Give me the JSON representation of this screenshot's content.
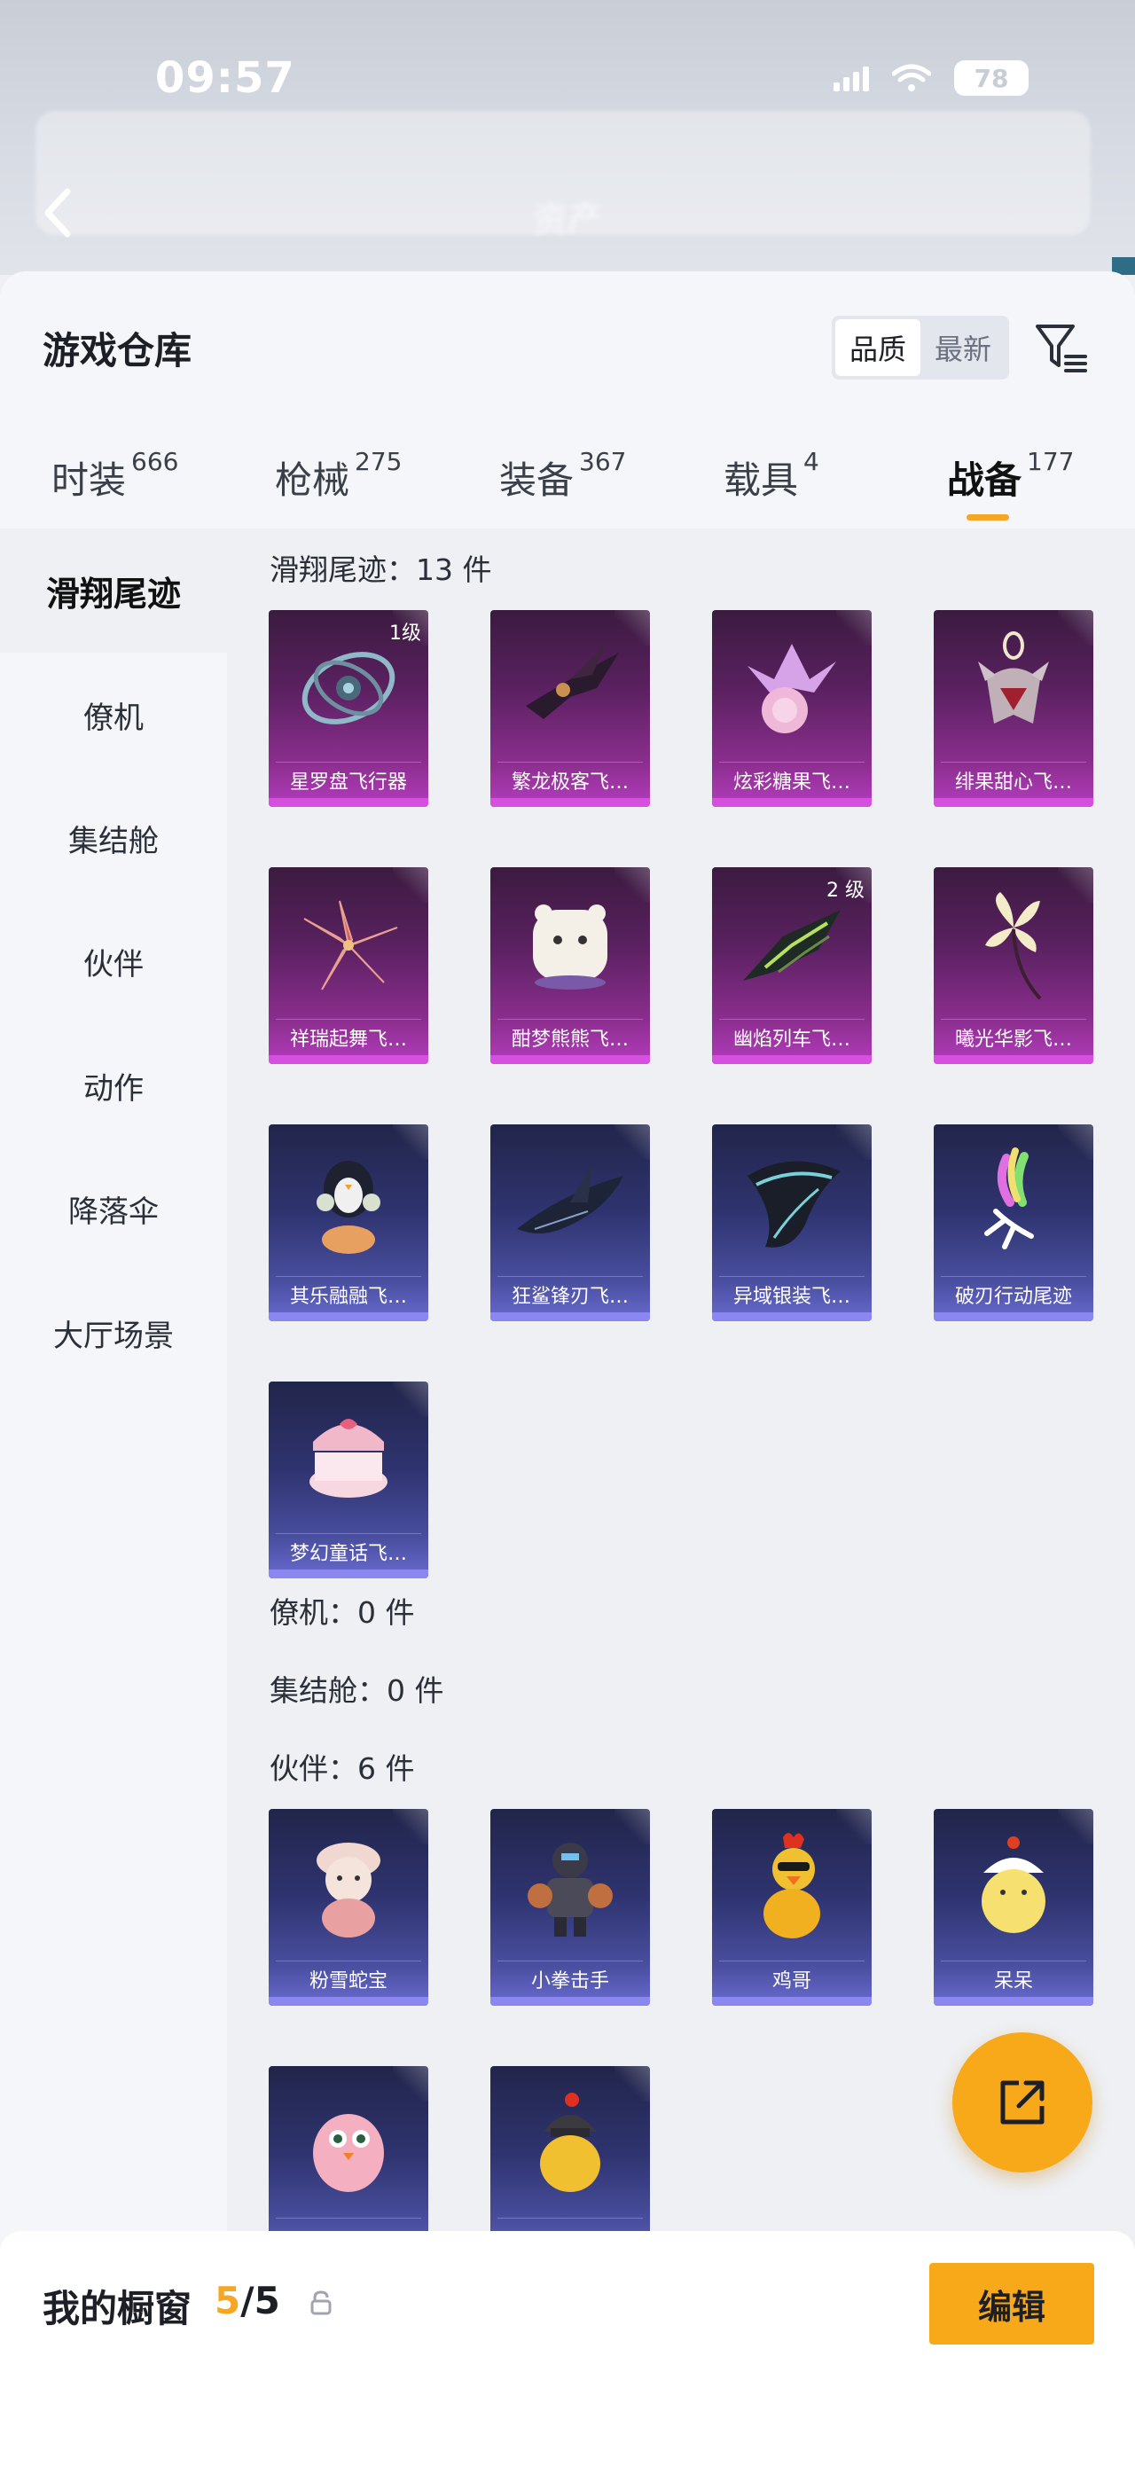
{
  "status_bar": {
    "time": "09:57",
    "battery": "78"
  },
  "header_bg": {
    "tab_hint": "资产"
  },
  "sheet": {
    "title": "游戏仓库",
    "sort": {
      "options": [
        "品质",
        "最新"
      ],
      "selected": "品质"
    }
  },
  "category_tabs": [
    {
      "label": "时装",
      "count": "666"
    },
    {
      "label": "枪械",
      "count": "275"
    },
    {
      "label": "装备",
      "count": "367"
    },
    {
      "label": "载具",
      "count": "4"
    },
    {
      "label": "战备",
      "count": "177",
      "active": true
    }
  ],
  "side_nav": [
    {
      "label": "滑翔尾迹",
      "active": true
    },
    {
      "label": "僚机"
    },
    {
      "label": "集结舱"
    },
    {
      "label": "伙伴"
    },
    {
      "label": "动作"
    },
    {
      "label": "降落伞"
    },
    {
      "label": "大厅场景"
    }
  ],
  "sections": {
    "glide": {
      "title": "滑翔尾迹：13 件",
      "items": [
        {
          "name": "星罗盘飞行器",
          "level": "1级",
          "icon": "astrolabe-glider-icon"
        },
        {
          "name": "繁龙极客飞…",
          "icon": "dragon-glider-icon"
        },
        {
          "name": "炫彩糖果飞…",
          "icon": "candy-glider-icon"
        },
        {
          "name": "绯果甜心飞…",
          "icon": "sweetheart-glider-icon"
        },
        {
          "name": "祥瑞起舞飞…",
          "icon": "dancing-glider-icon"
        },
        {
          "name": "酣梦熊熊飞…",
          "icon": "bear-glider-icon"
        },
        {
          "name": "幽焰列车飞…",
          "level": "2 级",
          "icon": "flame-train-glider-icon"
        },
        {
          "name": "曦光华影飞…",
          "icon": "flower-glider-icon"
        },
        {
          "name": "其乐融融飞…",
          "icon": "penguin-glider-icon"
        },
        {
          "name": "狂鲨锋刃飞…",
          "icon": "shark-glider-icon"
        },
        {
          "name": "异域银装飞…",
          "icon": "silver-wing-glider-icon"
        },
        {
          "name": "破刃行动尾迹",
          "icon": "smoke-trail-icon"
        },
        {
          "name": "梦幻童话飞…",
          "icon": "fairytale-glider-icon"
        }
      ]
    },
    "wingman": {
      "title": "僚机：0 件"
    },
    "pod": {
      "title": "集结舱：0 件"
    },
    "partner": {
      "title": "伙伴：6 件",
      "items": [
        {
          "name": "粉雪蛇宝",
          "icon": "snow-snake-partner-icon"
        },
        {
          "name": "小拳击手",
          "icon": "boxer-partner-icon"
        },
        {
          "name": "鸡哥",
          "icon": "rooster-partner-icon"
        },
        {
          "name": "呆呆",
          "icon": "chick-partner-icon"
        },
        {
          "name": "",
          "icon": "pink-bird-partner-icon"
        },
        {
          "name": "",
          "icon": "helmet-chick-partner-icon"
        }
      ]
    }
  },
  "showcase": {
    "label": "我的橱窗",
    "current": "5",
    "total": "/5",
    "edit_label": "编辑"
  },
  "colors": {
    "accent": "#f7a91a",
    "epic_purple": "#b43dbd",
    "rare_blue": "#6a6bd0"
  }
}
